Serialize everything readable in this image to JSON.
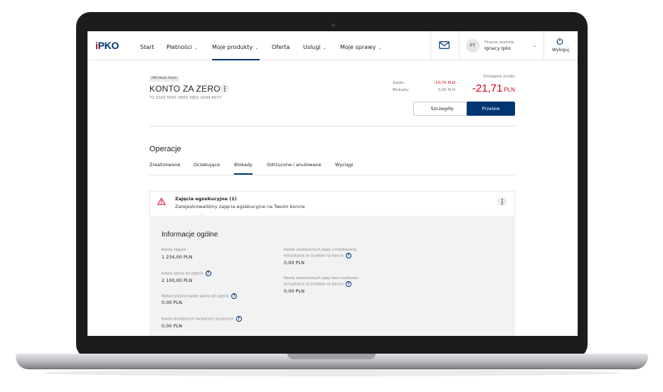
{
  "nav": {
    "logo_prefix": "i",
    "logo_main": "PKO",
    "items": [
      {
        "label": "Start",
        "dropdown": false
      },
      {
        "label": "Płatności",
        "dropdown": true
      },
      {
        "label": "Moje produkty",
        "dropdown": true,
        "active": true
      },
      {
        "label": "Oferta",
        "dropdown": false
      },
      {
        "label": "Usługi",
        "dropdown": true
      },
      {
        "label": "Moje sprawy",
        "dropdown": true
      }
    ],
    "chevron": "⌄",
    "user": {
      "initials": "PT",
      "role": "Finanse osobiste",
      "name": "Ignacy Ipko"
    },
    "logout_label": "Wyloguj"
  },
  "account": {
    "bank_badge": "PKO Bank Polski",
    "name": "KONTO ZA ZERO",
    "number": "72 1020 5561 0000 3902 0294 6077",
    "saldo_label": "Saldo:",
    "saldo_value": "-10,70 PLN",
    "blokady_label": "Blokady:",
    "blokady_value": "0,00 PLN",
    "available_label": "Dostępne środki",
    "available_amount": "-21,71",
    "available_currency": "PLN",
    "details_button": "Szczegóły",
    "transfer_button": "Przelew"
  },
  "operations": {
    "title": "Operacje",
    "tabs": [
      {
        "label": "Zrealizowane",
        "active": false
      },
      {
        "label": "Oczekujące",
        "active": false
      },
      {
        "label": "Blokady",
        "active": true
      },
      {
        "label": "Odrzucone i anulowane",
        "active": false
      },
      {
        "label": "Wyciągi",
        "active": false
      }
    ]
  },
  "alert": {
    "title": "Zajęcia egzekucyjne (1)",
    "description": "Zarejestrowaliśmy zajęcia egzekucyjne na Twoim koncie"
  },
  "details": {
    "title": "Informacje ogólne",
    "info_glyph": "?",
    "left_fields": [
      {
        "label": "Kwota zajęcia",
        "value": "1 234,00 PLN",
        "info": false
      },
      {
        "label": "Kwota wolna od zajęcia",
        "value": "2 100,00 PLN",
        "info": true
      },
      {
        "label": "Wykorzystano kwotę wolną od zajęcia",
        "value": "0,00 PLN",
        "info": true
      },
      {
        "label": "Kwota dostępnych świadczeń socjalnych",
        "value": "0,00 PLN",
        "info": true
      }
    ],
    "right_fields": [
      {
        "label_line1": "Kwota zawieszonych zajęć z możliwością",
        "label_line2": "korzystania ze środków na koncie",
        "value": "0,00 PLN",
        "info": true
      },
      {
        "label_line1": "Kwota zawieszonych zajęć bez możliwości",
        "label_line2": "korzystania ze środków na koncie",
        "value": "0,00 PLN",
        "info": true
      }
    ]
  },
  "colors": {
    "brand_navy": "#003574",
    "brand_red": "#d6001c",
    "panel_gray": "#f2f2f2"
  },
  "icons": [
    "mail-icon",
    "power-icon",
    "kebab-menu-icon",
    "warning-icon",
    "info-icon",
    "chevron-down-icon"
  ]
}
